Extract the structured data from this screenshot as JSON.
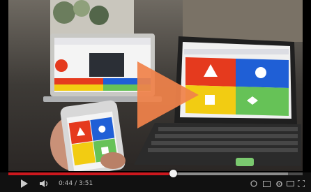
{
  "player": {
    "progress_fraction": 0.56,
    "loaded_fraction": 0.95,
    "time_display": "0:44 / 3:51"
  },
  "icons": {
    "play_overlay": "play-triangle-icon",
    "play": "play-icon",
    "volume": "volume-icon",
    "watch_later": "clock-icon",
    "captions": "captions-icon",
    "settings": "gear-icon",
    "size": "theater-icon",
    "fullscreen": "fullscreen-icon"
  },
  "colors": {
    "progress_played": "#cc181e",
    "play_overlay": "#f0824a",
    "tile_red": "#e53a1e",
    "tile_blue": "#1f5fd6",
    "tile_yellow": "#f2cc12",
    "tile_green": "#66c257"
  }
}
